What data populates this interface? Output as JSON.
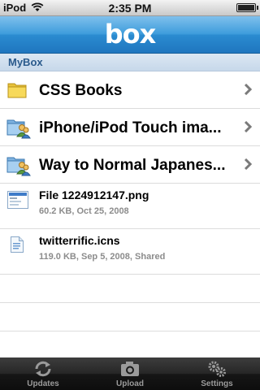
{
  "status": {
    "carrier": "iPod",
    "time": "2:35 PM"
  },
  "nav": {
    "logo": "box"
  },
  "section": {
    "title": "MyBox"
  },
  "folders": [
    {
      "name": "CSS Books",
      "icon": "folder-icon"
    },
    {
      "name": "iPhone/iPod Touch ima...",
      "icon": "shared-folder-icon"
    },
    {
      "name": "Way to Normal Japanes...",
      "icon": "shared-folder-icon"
    }
  ],
  "files": [
    {
      "name": "File 1224912147.png",
      "meta": "60.2 KB, Oct 25, 2008",
      "icon": "image-file-icon"
    },
    {
      "name": "twitterrific.icns",
      "meta": "119.0 KB, Sep 5, 2008, Shared",
      "icon": "document-file-icon"
    }
  ],
  "tabs": [
    {
      "label": "Updates",
      "icon": "refresh-icon"
    },
    {
      "label": "Upload",
      "icon": "camera-icon"
    },
    {
      "label": "Settings",
      "icon": "gears-icon"
    }
  ],
  "colors": {
    "nav_blue": "#2a8bd0",
    "section_text": "#2a5a8c",
    "meta_gray": "#8c8c8c"
  }
}
